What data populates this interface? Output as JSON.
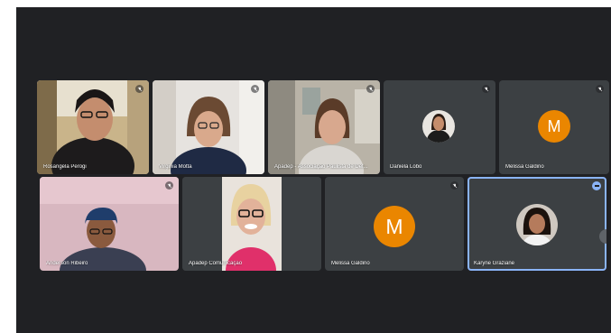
{
  "participants": [
    {
      "name": "Rosangela Perogi",
      "type": "video"
    },
    {
      "name": "Virginia Motta",
      "type": "video"
    },
    {
      "name": "Apadep - Associação Paulista de Def...",
      "type": "video"
    },
    {
      "name": "Daniela Lobo",
      "type": "photo"
    },
    {
      "name": "Melissa Galdino",
      "type": "letter",
      "initial": "M",
      "color": "#ea8600"
    },
    {
      "name": "Anderson Ribeiro",
      "type": "video"
    },
    {
      "name": "Apadep Comunicação",
      "type": "video"
    },
    {
      "name": "Melissa Galdino",
      "type": "letter",
      "initial": "M",
      "color": "#ea8600"
    },
    {
      "name": "Karyne Graziane",
      "type": "photo",
      "active": true
    }
  ],
  "colors": {
    "stage": "#202124",
    "tile": "#3c4043",
    "accent": "#8ab4f8",
    "avatar": "#ea8600"
  },
  "icons": [
    "mic-off-icon",
    "more-options-icon"
  ]
}
